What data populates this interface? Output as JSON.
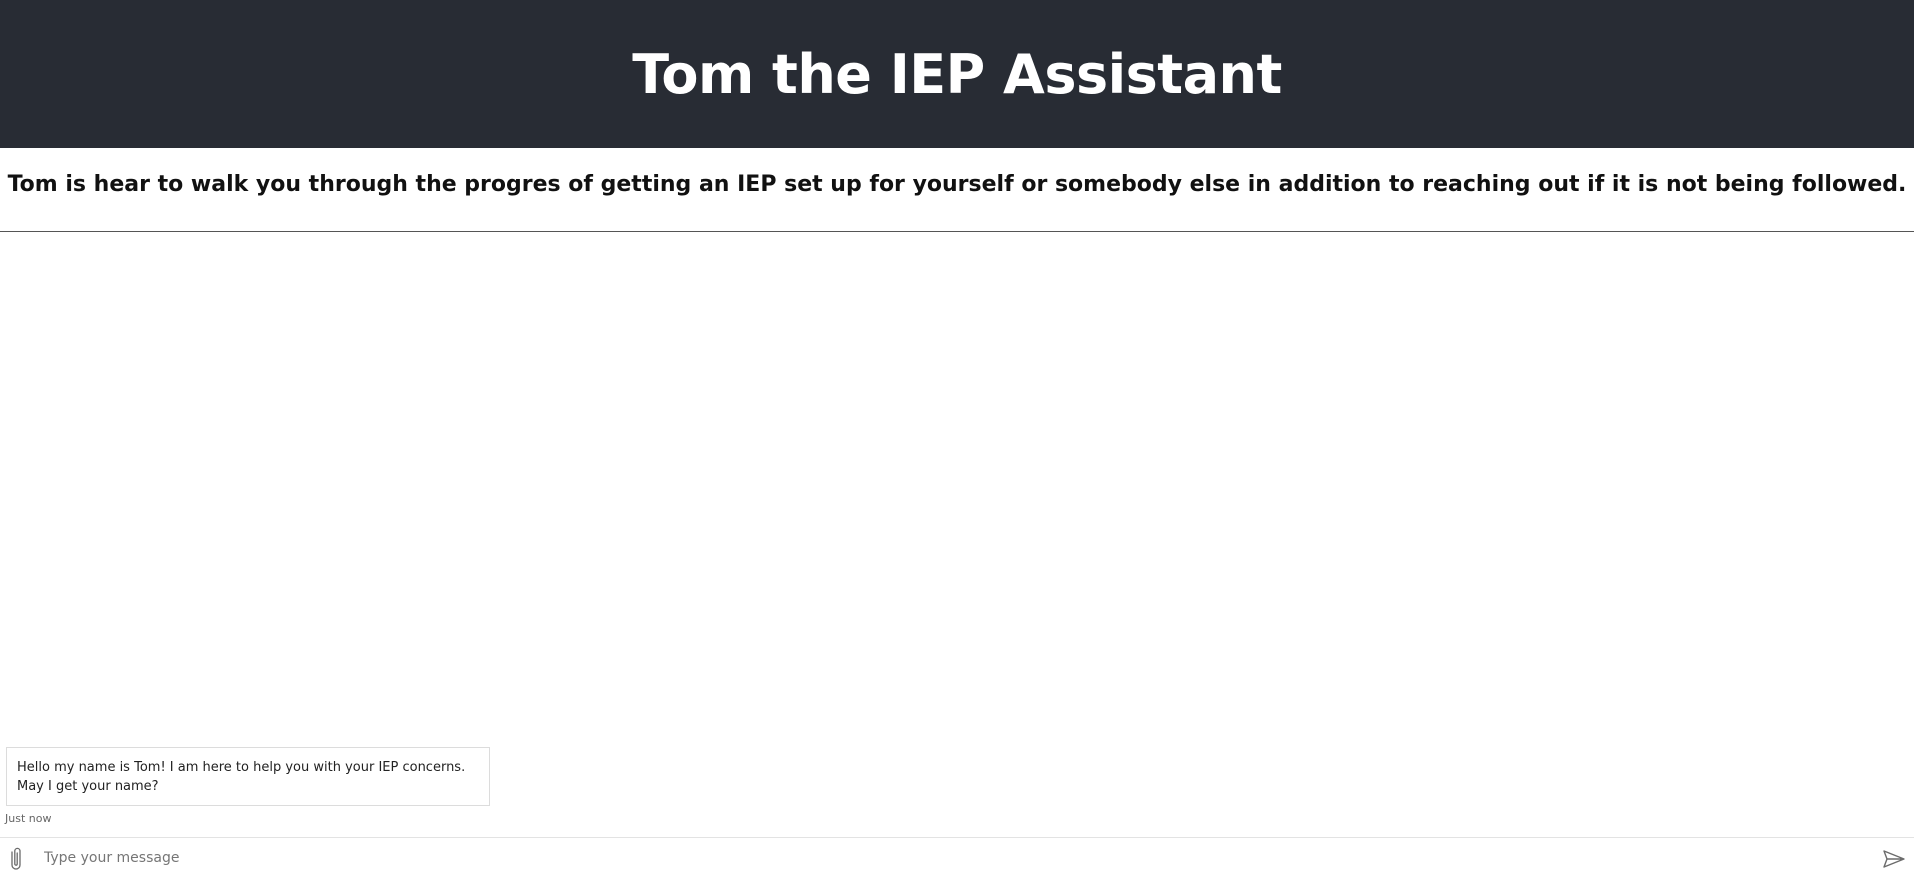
{
  "header": {
    "title": "Tom the IEP Assistant"
  },
  "intro": {
    "text": "Tom is hear to walk you through the progres of getting an IEP set up for yourself or somebody else in addition to reaching out if it is not being followed."
  },
  "chat": {
    "messages": [
      {
        "line1": "Hello my name is Tom! I am here to help you with your IEP concerns.",
        "line2": "May I get your name?",
        "timestamp": "Just now"
      }
    ]
  },
  "composer": {
    "placeholder": "Type your message",
    "value": "",
    "attach_icon": "paperclip-icon",
    "send_icon": "send-icon"
  },
  "colors": {
    "header_bg": "#282c34",
    "header_text": "#ffffff"
  }
}
